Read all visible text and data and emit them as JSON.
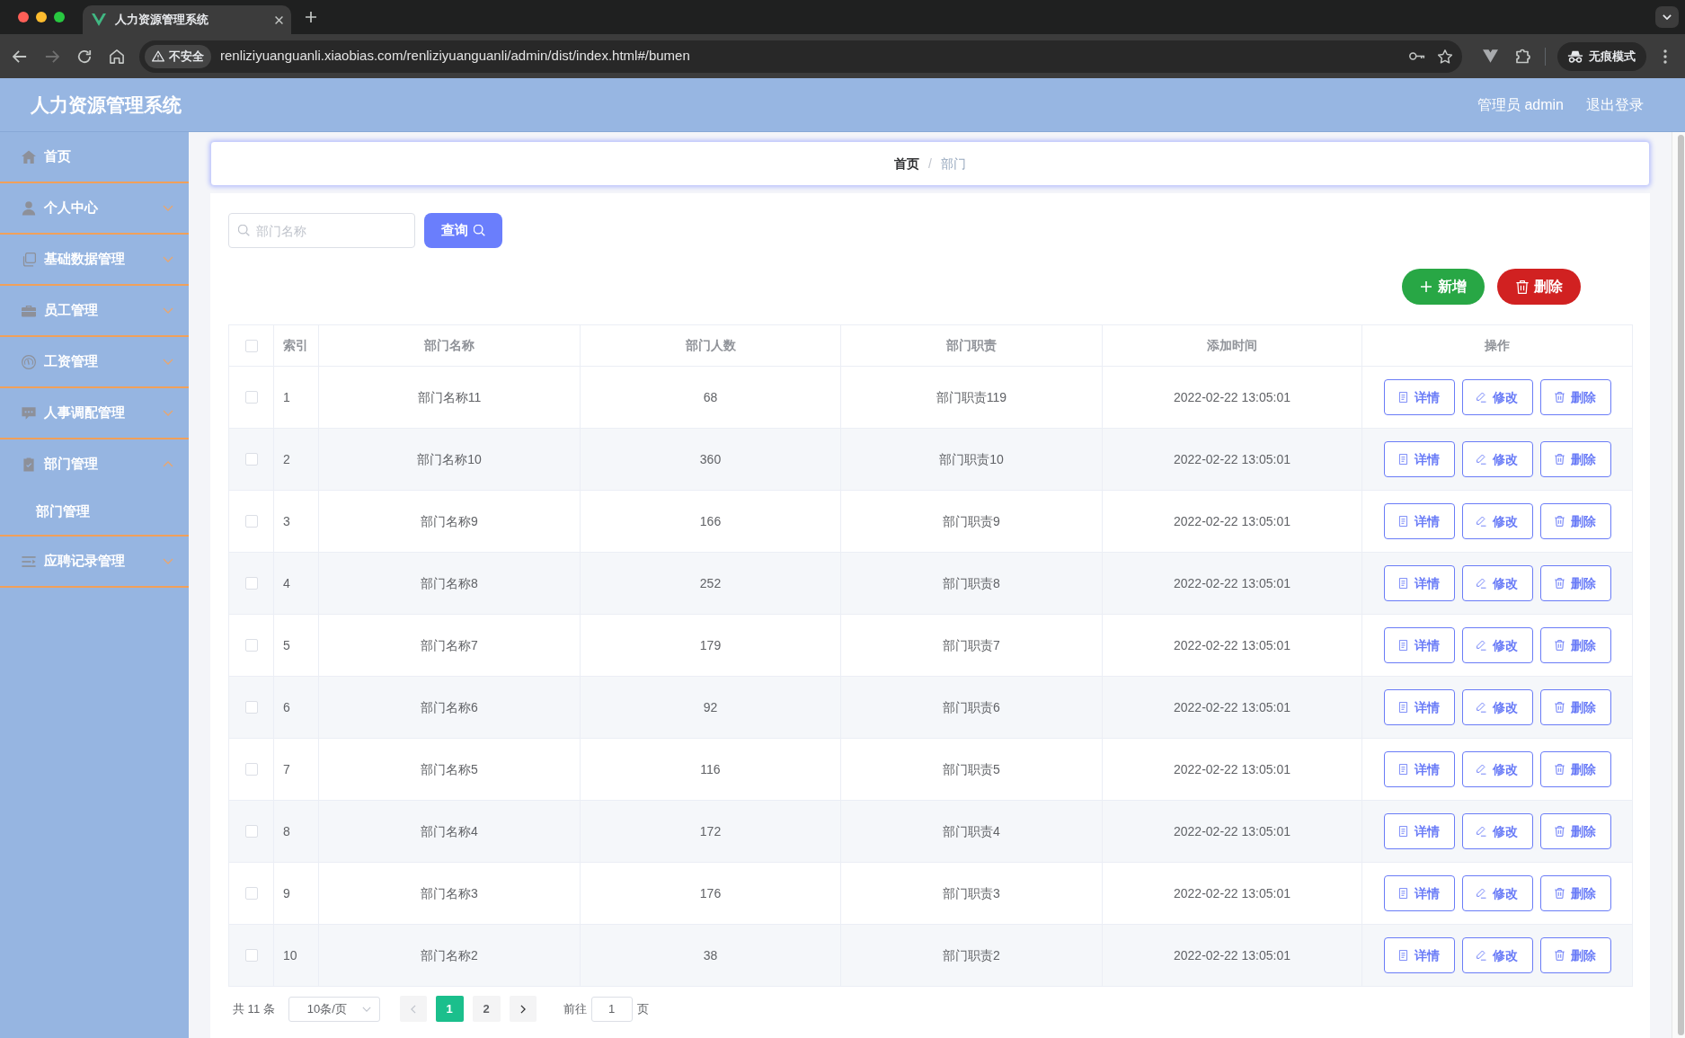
{
  "browser": {
    "tab_title": "人力资源管理系统",
    "security": "不安全",
    "url": "renliziyuanguanli.xiaobias.com/renliziyuanguanli/admin/dist/index.html#/bumen",
    "profile": "无痕模式"
  },
  "header": {
    "title": "人力资源管理系统",
    "user": "管理员 admin",
    "logout": "退出登录"
  },
  "sidebar": {
    "items": [
      {
        "label": "首页",
        "kind": "link"
      },
      {
        "label": "个人中心",
        "kind": "menu",
        "expanded": false
      },
      {
        "label": "基础数据管理",
        "kind": "menu",
        "expanded": false
      },
      {
        "label": "员工管理",
        "kind": "menu",
        "expanded": false
      },
      {
        "label": "工资管理",
        "kind": "menu",
        "expanded": false
      },
      {
        "label": "人事调配管理",
        "kind": "menu",
        "expanded": false
      },
      {
        "label": "部门管理",
        "kind": "menu",
        "expanded": true,
        "children": [
          {
            "label": "部门管理"
          }
        ]
      },
      {
        "label": "应聘记录管理",
        "kind": "menu",
        "expanded": false
      }
    ]
  },
  "breadcrumb": {
    "separator": "/",
    "items": [
      {
        "label": "首页",
        "current": false
      },
      {
        "label": "部门",
        "current": true
      }
    ]
  },
  "search": {
    "placeholder": "部门名称",
    "button": "查询"
  },
  "toolbar": {
    "add": "新增",
    "delete": "删除"
  },
  "table": {
    "select_all_checked": false,
    "columns": [
      "索引",
      "部门名称",
      "部门人数",
      "部门职责",
      "添加时间",
      "操作"
    ],
    "rows": [
      {
        "checked": false,
        "cells": [
          "1",
          "部门名称11",
          "68",
          "部门职责119",
          "2022-02-22 13:05:01"
        ],
        "actions": [
          {
            "label": "详情",
            "kind": "detail"
          },
          {
            "label": "修改",
            "kind": "edit"
          },
          {
            "label": "删除",
            "kind": "delete"
          }
        ]
      },
      {
        "checked": false,
        "cells": [
          "2",
          "部门名称10",
          "360",
          "部门职责10",
          "2022-02-22 13:05:01"
        ],
        "actions": [
          {
            "label": "详情",
            "kind": "detail"
          },
          {
            "label": "修改",
            "kind": "edit"
          },
          {
            "label": "删除",
            "kind": "delete"
          }
        ]
      },
      {
        "checked": false,
        "cells": [
          "3",
          "部门名称9",
          "166",
          "部门职责9",
          "2022-02-22 13:05:01"
        ],
        "actions": [
          {
            "label": "详情",
            "kind": "detail"
          },
          {
            "label": "修改",
            "kind": "edit"
          },
          {
            "label": "删除",
            "kind": "delete"
          }
        ]
      },
      {
        "checked": false,
        "cells": [
          "4",
          "部门名称8",
          "252",
          "部门职责8",
          "2022-02-22 13:05:01"
        ],
        "actions": [
          {
            "label": "详情",
            "kind": "detail"
          },
          {
            "label": "修改",
            "kind": "edit"
          },
          {
            "label": "删除",
            "kind": "delete"
          }
        ]
      },
      {
        "checked": false,
        "cells": [
          "5",
          "部门名称7",
          "179",
          "部门职责7",
          "2022-02-22 13:05:01"
        ],
        "actions": [
          {
            "label": "详情",
            "kind": "detail"
          },
          {
            "label": "修改",
            "kind": "edit"
          },
          {
            "label": "删除",
            "kind": "delete"
          }
        ]
      },
      {
        "checked": false,
        "cells": [
          "6",
          "部门名称6",
          "92",
          "部门职责6",
          "2022-02-22 13:05:01"
        ],
        "actions": [
          {
            "label": "详情",
            "kind": "detail"
          },
          {
            "label": "修改",
            "kind": "edit"
          },
          {
            "label": "删除",
            "kind": "delete"
          }
        ]
      },
      {
        "checked": false,
        "cells": [
          "7",
          "部门名称5",
          "116",
          "部门职责5",
          "2022-02-22 13:05:01"
        ],
        "actions": [
          {
            "label": "详情",
            "kind": "detail"
          },
          {
            "label": "修改",
            "kind": "edit"
          },
          {
            "label": "删除",
            "kind": "delete"
          }
        ]
      },
      {
        "checked": false,
        "cells": [
          "8",
          "部门名称4",
          "172",
          "部门职责4",
          "2022-02-22 13:05:01"
        ],
        "actions": [
          {
            "label": "详情",
            "kind": "detail"
          },
          {
            "label": "修改",
            "kind": "edit"
          },
          {
            "label": "删除",
            "kind": "delete"
          }
        ]
      },
      {
        "checked": false,
        "cells": [
          "9",
          "部门名称3",
          "176",
          "部门职责3",
          "2022-02-22 13:05:01"
        ],
        "actions": [
          {
            "label": "详情",
            "kind": "detail"
          },
          {
            "label": "修改",
            "kind": "edit"
          },
          {
            "label": "删除",
            "kind": "delete"
          }
        ]
      },
      {
        "checked": false,
        "cells": [
          "10",
          "部门名称2",
          "38",
          "部门职责2",
          "2022-02-22 13:05:01"
        ],
        "actions": [
          {
            "label": "详情",
            "kind": "detail"
          },
          {
            "label": "修改",
            "kind": "edit"
          },
          {
            "label": "删除",
            "kind": "delete"
          }
        ]
      }
    ]
  },
  "pagination": {
    "total": "共 11 条",
    "page_size": "10条/页",
    "prev_disabled": true,
    "next_disabled": false,
    "pages": [
      {
        "label": "1",
        "selected": true
      },
      {
        "label": "2",
        "selected": false
      }
    ],
    "jump_label": "前往",
    "jump_value": "1",
    "jump_suffix": "页"
  }
}
